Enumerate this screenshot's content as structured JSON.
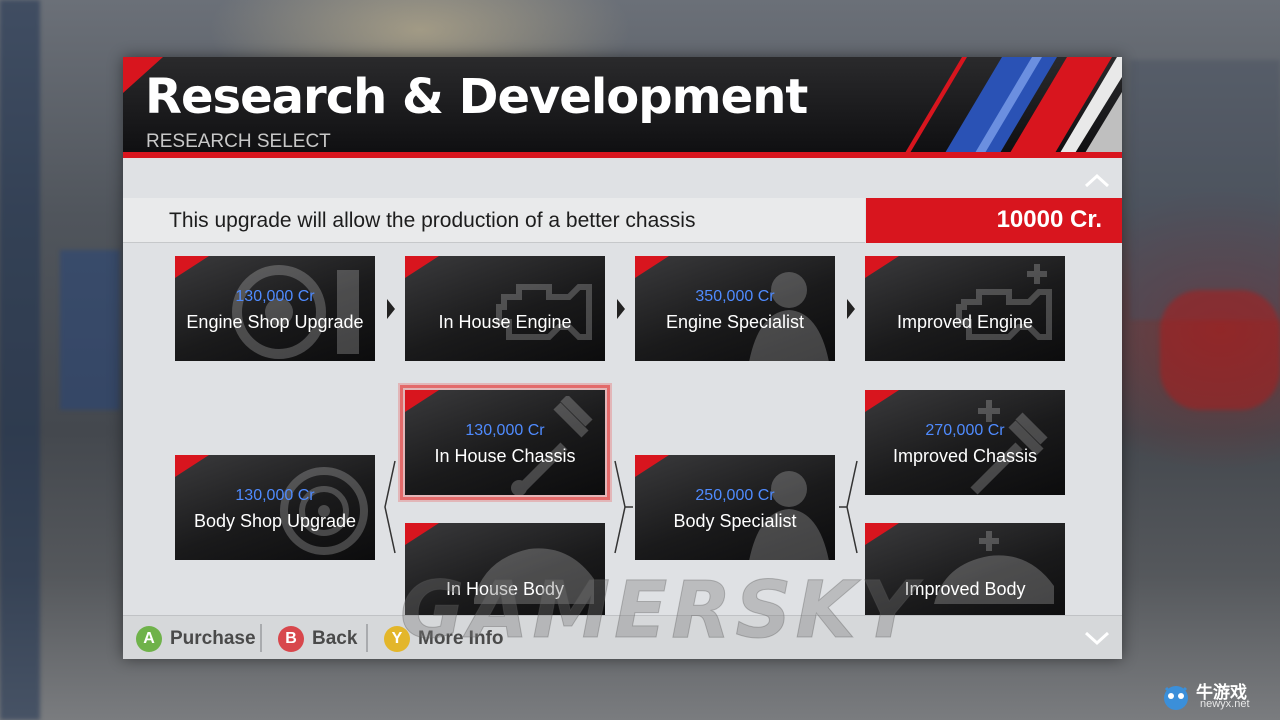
{
  "header": {
    "title": "Research & Development",
    "subtitle": "RESEARCH SELECT"
  },
  "info": {
    "description": "This upgrade will allow the production of a better chassis",
    "price": "10000 Cr."
  },
  "tiles": {
    "engine_shop_upgrade": {
      "cost": "130,000 Cr",
      "name": "Engine Shop Upgrade"
    },
    "in_house_engine": {
      "cost": "",
      "name": "In House Engine"
    },
    "engine_specialist": {
      "cost": "350,000 Cr",
      "name": "Engine Specialist"
    },
    "improved_engine": {
      "cost": "",
      "name": "Improved Engine"
    },
    "body_shop_upgrade": {
      "cost": "130,000 Cr",
      "name": "Body Shop Upgrade"
    },
    "in_house_chassis": {
      "cost": "130,000 Cr",
      "name": "In House Chassis"
    },
    "in_house_body": {
      "cost": "",
      "name": "In House Body"
    },
    "body_specialist": {
      "cost": "250,000 Cr",
      "name": "Body Specialist"
    },
    "improved_chassis": {
      "cost": "270,000 Cr",
      "name": "Improved Chassis"
    },
    "improved_body": {
      "cost": "",
      "name": "Improved Body"
    }
  },
  "footer": {
    "purchase": {
      "key": "A",
      "label": "Purchase",
      "color": "#6fb24a"
    },
    "back": {
      "key": "B",
      "label": "Back",
      "color": "#d8474c"
    },
    "more_info": {
      "key": "Y",
      "label": "More Info",
      "color": "#e3b62a"
    }
  },
  "watermark": "GAMERSKY",
  "site_logo": {
    "name": "牛游戏",
    "url": "newyx.net"
  },
  "colors": {
    "accent_red": "#d8151e",
    "cost_blue": "#4f8bff",
    "panel_bg": "#dfe1e4",
    "header_bg": "#0e0e10"
  }
}
